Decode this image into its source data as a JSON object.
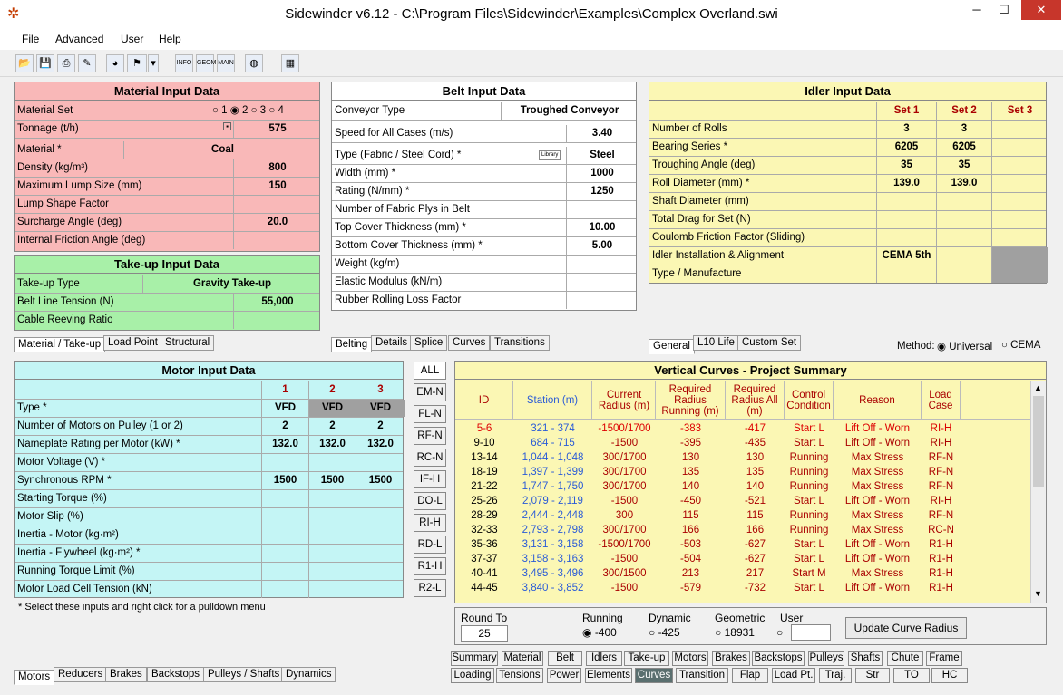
{
  "window": {
    "title": "Sidewinder v6.12 - C:\\Program Files\\Sidewinder\\Examples\\Complex Overland.swi"
  },
  "menu": [
    "File",
    "Advanced",
    "User",
    "Help"
  ],
  "toolbar": {
    "buttons": [
      "open-icon",
      "save-icon",
      "print-icon",
      "edit-icon",
      "chart-icon",
      "flag-icon",
      "info-icon",
      "geom-icon",
      "main-icon",
      "palette-icon",
      "calculator-icon"
    ],
    "info": "INFO",
    "geom": "GEOM",
    "main": "MAIN"
  },
  "material": {
    "title": "Material Input Data",
    "rows": [
      {
        "label": "Material Set",
        "value": ""
      },
      {
        "label": "Tonnage (t/h)",
        "value": "575"
      },
      {
        "label": "Material *",
        "value": "Coal"
      },
      {
        "label": "Density (kg/m³)",
        "value": "800"
      },
      {
        "label": "Maximum Lump Size (mm)",
        "value": "150"
      },
      {
        "label": "Lump Shape Factor",
        "value": ""
      },
      {
        "label": "Surcharge Angle (deg)",
        "value": "20.0"
      },
      {
        "label": "Internal Friction Angle (deg)",
        "value": ""
      }
    ],
    "sets": [
      "1",
      "2",
      "3",
      "4"
    ],
    "selected_set": "2"
  },
  "takeup": {
    "title": "Take-up Input Data",
    "rows": [
      {
        "label": "Take-up Type",
        "value": "Gravity Take-up"
      },
      {
        "label": "Belt Line Tension (N)",
        "value": "55,000"
      },
      {
        "label": "Cable Reeving Ratio",
        "value": ""
      }
    ]
  },
  "left_tabs": [
    "Material / Take-up",
    "Load Point",
    "Structural"
  ],
  "belt": {
    "title": "Belt Input Data",
    "type_label": "Conveyor Type",
    "type_value": "Troughed Conveyor",
    "speed_label": "Speed for All Cases (m/s)",
    "speed_value": "3.40",
    "library": "Library",
    "rows": [
      {
        "label": "Type (Fabric / Steel Cord) *",
        "value": "Steel"
      },
      {
        "label": "Width (mm) *",
        "value": "1000"
      },
      {
        "label": "Rating (N/mm) *",
        "value": "1250"
      },
      {
        "label": "Number of Fabric Plys in Belt",
        "value": ""
      },
      {
        "label": "Top Cover Thickness (mm) *",
        "value": "10.00"
      },
      {
        "label": "Bottom Cover Thickness (mm) *",
        "value": "5.00"
      },
      {
        "label": "Weight (kg/m)",
        "value": ""
      },
      {
        "label": "Elastic Modulus (kN/m)",
        "value": ""
      },
      {
        "label": "Rubber Rolling Loss Factor",
        "value": ""
      }
    ]
  },
  "belt_tabs": [
    "Belting",
    "Details",
    "Splice",
    "Curves",
    "Transitions"
  ],
  "idler": {
    "title": "Idler Input Data",
    "sets": [
      "Set 1",
      "Set 2",
      "Set 3"
    ],
    "rows": [
      {
        "label": "Number of Rolls",
        "v": [
          "3",
          "3",
          ""
        ]
      },
      {
        "label": "Bearing Series *",
        "v": [
          "6205",
          "6205",
          ""
        ]
      },
      {
        "label": "Troughing Angle (deg)",
        "v": [
          "35",
          "35",
          ""
        ]
      },
      {
        "label": "Roll Diameter (mm) *",
        "v": [
          "139.0",
          "139.0",
          ""
        ]
      },
      {
        "label": "Shaft Diameter (mm)",
        "v": [
          "",
          "",
          ""
        ]
      },
      {
        "label": "Total Drag for Set (N)",
        "v": [
          "",
          "",
          ""
        ]
      },
      {
        "label": "Coulomb Friction Factor (Sliding)",
        "v": [
          "",
          "",
          ""
        ]
      },
      {
        "label": "Idler Installation & Alignment",
        "v": [
          "CEMA 5th",
          "",
          ""
        ]
      },
      {
        "label": "Type / Manufacture",
        "v": [
          "",
          "",
          ""
        ]
      }
    ]
  },
  "idler_tabs": [
    "General",
    "L10 Life",
    "Custom Set"
  ],
  "method": {
    "label": "Method:",
    "options": [
      "Universal",
      "CEMA"
    ],
    "selected": "Universal"
  },
  "motor": {
    "title": "Motor Input Data",
    "cols": [
      "1",
      "2",
      "3"
    ],
    "rows": [
      {
        "label": "Type *",
        "v": [
          "VFD",
          "VFD",
          "VFD"
        ]
      },
      {
        "label": "Number of Motors on Pulley (1 or 2)",
        "v": [
          "2",
          "2",
          "2"
        ]
      },
      {
        "label": "Nameplate Rating per Motor (kW) *",
        "v": [
          "132.0",
          "132.0",
          "132.0"
        ]
      },
      {
        "label": "Motor Voltage (V) *",
        "v": [
          "",
          "",
          ""
        ]
      },
      {
        "label": "Synchronous RPM *",
        "v": [
          "1500",
          "1500",
          "1500"
        ]
      },
      {
        "label": "Starting Torque (%)",
        "v": [
          "",
          "",
          ""
        ]
      },
      {
        "label": "Motor Slip (%)",
        "v": [
          "",
          "",
          ""
        ]
      },
      {
        "label": "Inertia - Motor (kg·m²)",
        "v": [
          "",
          "",
          ""
        ]
      },
      {
        "label": "Inertia - Flywheel (kg·m²) *",
        "v": [
          "",
          "",
          ""
        ]
      },
      {
        "label": "Running Torque Limit (%)",
        "v": [
          "",
          "",
          ""
        ]
      },
      {
        "label": "Motor Load Cell Tension (kN)",
        "v": [
          "",
          "",
          ""
        ]
      }
    ],
    "note": "* Select these inputs and right click for a pulldown menu"
  },
  "motor_tabs": [
    "Motors",
    "Reducers",
    "Brakes",
    "Backstops",
    "Pulleys / Shafts",
    "Dynamics"
  ],
  "side_buttons": [
    "ALL",
    "EM-N",
    "FL-N",
    "RF-N",
    "RC-N",
    "IF-H",
    "DO-L",
    "RI-H",
    "RD-L",
    "R1-H",
    "R2-L"
  ],
  "curves": {
    "title": "Vertical Curves - Project Summary",
    "headers": [
      "ID",
      "Station (m)",
      "Current Radius (m)",
      "Required Radius Running (m)",
      "Required Radius All (m)",
      "Control Condition",
      "Reason",
      "Load Case"
    ],
    "rows": [
      [
        "5-6",
        "321 - 374",
        "-1500/1700",
        "-383",
        "-417",
        "Start L",
        "Lift Off - Worn",
        "RI-H"
      ],
      [
        "9-10",
        "684 - 715",
        "-1500",
        "-395",
        "-435",
        "Start L",
        "Lift Off - Worn",
        "RI-H"
      ],
      [
        "13-14",
        "1,044 - 1,048",
        "300/1700",
        "130",
        "130",
        "Running",
        "Max Stress",
        "RF-N"
      ],
      [
        "18-19",
        "1,397 - 1,399",
        "300/1700",
        "135",
        "135",
        "Running",
        "Max Stress",
        "RF-N"
      ],
      [
        "21-22",
        "1,747 - 1,750",
        "300/1700",
        "140",
        "140",
        "Running",
        "Max Stress",
        "RF-N"
      ],
      [
        "25-26",
        "2,079 - 2,119",
        "-1500",
        "-450",
        "-521",
        "Start L",
        "Lift Off - Worn",
        "RI-H"
      ],
      [
        "28-29",
        "2,444 - 2,448",
        "300",
        "115",
        "115",
        "Running",
        "Max Stress",
        "RF-N"
      ],
      [
        "32-33",
        "2,793 - 2,798",
        "300/1700",
        "166",
        "166",
        "Running",
        "Max Stress",
        "RC-N"
      ],
      [
        "35-36",
        "3,131 - 3,158",
        "-1500/1700",
        "-503",
        "-627",
        "Start L",
        "Lift Off - Worn",
        "R1-H"
      ],
      [
        "37-37",
        "3,158 - 3,163",
        "-1500",
        "-504",
        "-627",
        "Start L",
        "Lift Off - Worn",
        "R1-H"
      ],
      [
        "40-41",
        "3,495 - 3,496",
        "300/1500",
        "213",
        "217",
        "Start M",
        "Max Stress",
        "R1-H"
      ],
      [
        "44-45",
        "3,840 - 3,852",
        "-1500",
        "-579",
        "-732",
        "Start L",
        "Lift Off - Worn",
        "R1-H"
      ]
    ]
  },
  "round": {
    "round_label": "Round To",
    "round_value": "25",
    "running_label": "Running",
    "running_value": "-400",
    "dynamic_label": "Dynamic",
    "dynamic_value": "-425",
    "geometric_label": "Geometric",
    "geometric_value": "18931",
    "user_label": "User",
    "update_button": "Update Curve Radius"
  },
  "bottom_tabs_row1": [
    "Summary",
    "Material",
    "Belt",
    "Idlers",
    "Take-up",
    "Motors",
    "Brakes",
    "Backstops",
    "Pulleys",
    "Shafts",
    "Chute",
    "Frame"
  ],
  "bottom_tabs_row2": [
    "Loading",
    "Tensions",
    "Power",
    "Elements",
    "Curves",
    "Transition",
    "Flap",
    "Load Pt.",
    "Traj.",
    "Str",
    "TO",
    "HC"
  ],
  "active_bottom_tab": "Curves"
}
